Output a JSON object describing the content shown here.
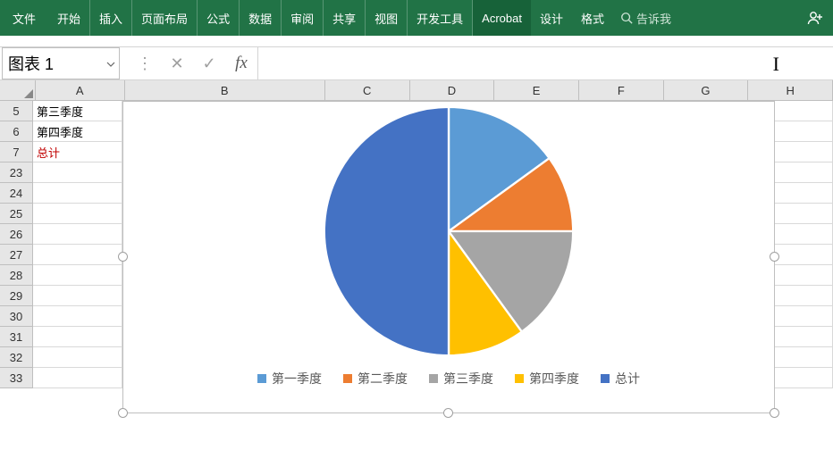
{
  "ribbon": {
    "tabs": [
      "文件",
      "开始",
      "插入",
      "页面布局",
      "公式",
      "数据",
      "审阅",
      "共享",
      "视图",
      "开发工具",
      "Acrobat",
      "设计",
      "格式"
    ],
    "active_tab": "Acrobat",
    "tell_me": "告诉我"
  },
  "name_box": {
    "value": "图表 1"
  },
  "formula_bar": {
    "cancel": "✕",
    "confirm": "✓",
    "fx": "fx",
    "value": ""
  },
  "columns": [
    "A",
    "B",
    "C",
    "D",
    "E",
    "F",
    "G",
    "H"
  ],
  "rows": [
    "5",
    "6",
    "7",
    "23",
    "24",
    "25",
    "26",
    "27",
    "28",
    "29",
    "30",
    "31",
    "32",
    "33"
  ],
  "cells": {
    "A5": "第三季度",
    "A6": "第四季度",
    "A7": "总计"
  },
  "chart_data": {
    "type": "pie",
    "title": "",
    "series": [
      {
        "name": "第一季度",
        "value": 15,
        "color": "#5b9bd5"
      },
      {
        "name": "第二季度",
        "value": 10,
        "color": "#ed7d31"
      },
      {
        "name": "第三季度",
        "value": 15,
        "color": "#a5a5a5"
      },
      {
        "name": "第四季度",
        "value": 10,
        "color": "#ffc000"
      },
      {
        "name": "总计",
        "value": 50,
        "color": "#4472c4"
      }
    ]
  }
}
